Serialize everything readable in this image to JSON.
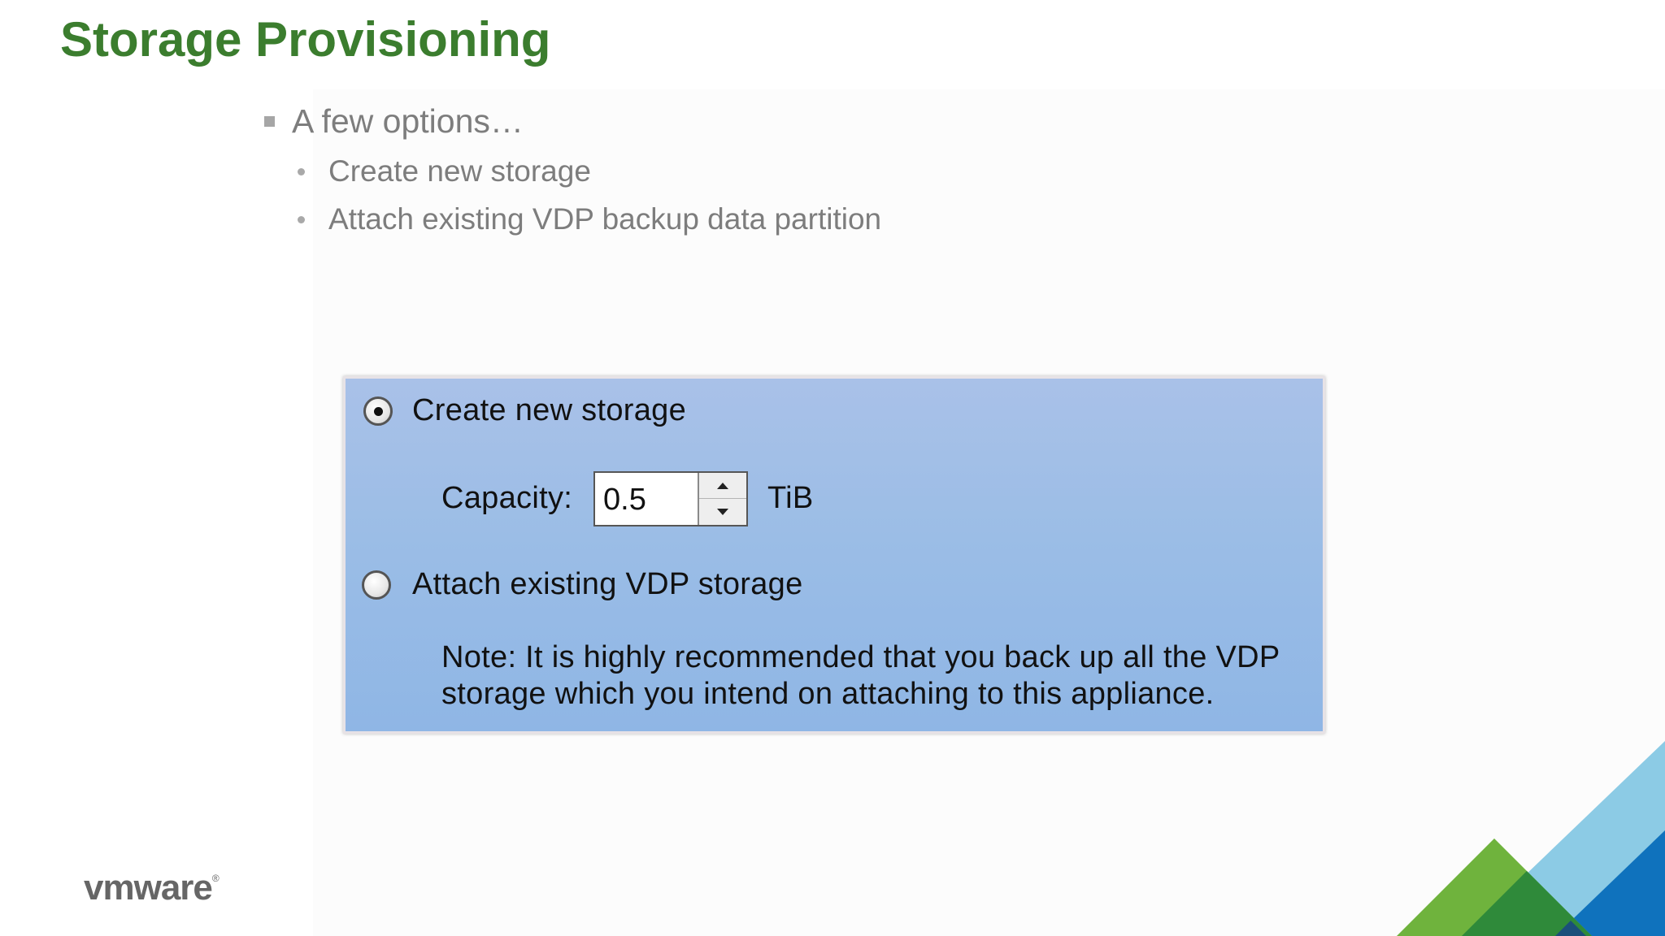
{
  "slide": {
    "title": "Storage Provisioning",
    "bullet": "A few options…",
    "subbullets": [
      "Create new storage",
      "Attach existing VDP backup data partition"
    ]
  },
  "dialog": {
    "option_create_label": "Create new storage",
    "option_create_selected": true,
    "capacity_label": "Capacity:",
    "capacity_value": "0.5",
    "capacity_unit": "TiB",
    "option_attach_label": "Attach existing VDP storage",
    "option_attach_selected": false,
    "note_line1": "Note:  It is highly recommended that you back up all the VDP",
    "note_line2": "storage which you intend on attaching to this appliance."
  },
  "branding": {
    "logo_text": "vmware",
    "logo_mark": "®"
  },
  "colors": {
    "title_green": "#3b7d2e",
    "bullet_gray": "#7d7d7d",
    "panel_blue": "#9bbde6",
    "corner_green_light": "#6fb33d",
    "corner_green_dark": "#2f8a3a",
    "corner_blue_light": "#8ccbe5",
    "corner_blue_dark": "#0f72bd"
  }
}
